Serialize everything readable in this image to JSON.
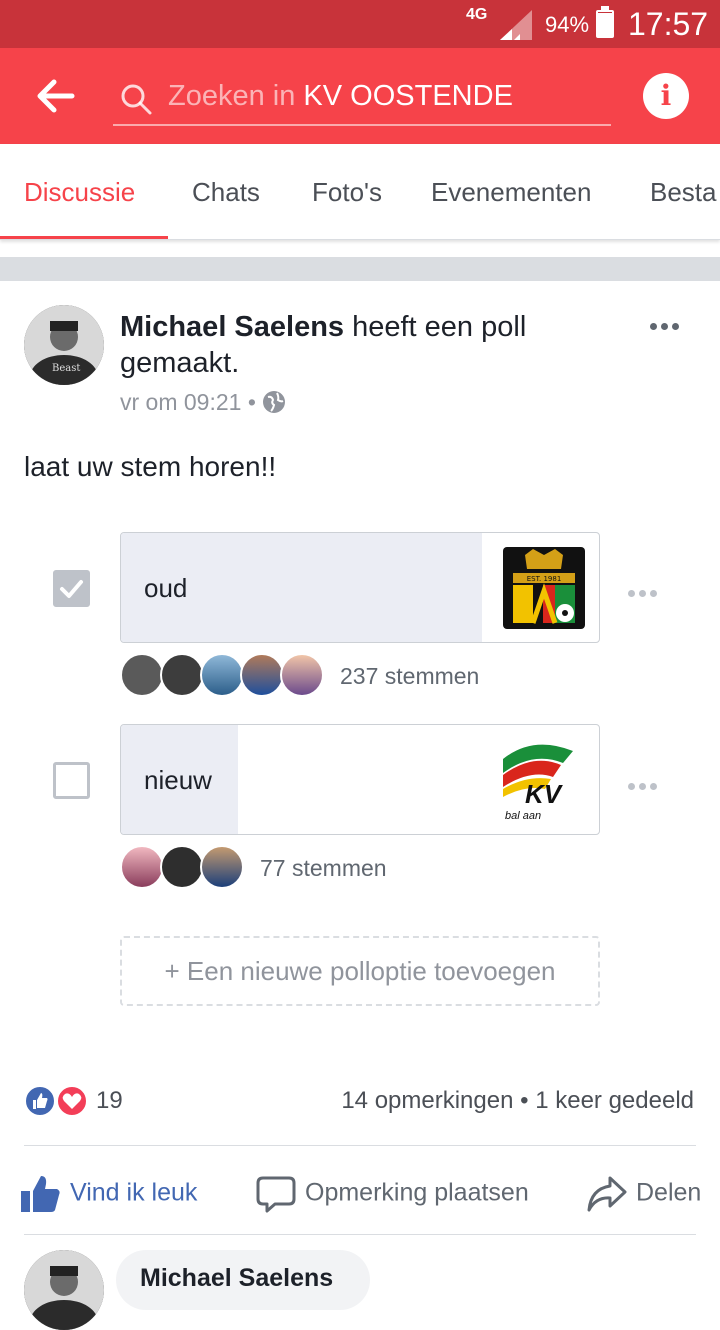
{
  "status": {
    "network": "4G",
    "battery": "94%",
    "battery_level": 0.94,
    "time": "17:57"
  },
  "appbar": {
    "search_placeholder": "Zoeken in ",
    "search_group": "KV OOSTENDE",
    "back_icon": "arrow-left-icon",
    "info_icon": "info-icon"
  },
  "tabs": [
    "Discussie",
    "Chats",
    "Foto's",
    "Evenementen",
    "Besta"
  ],
  "post": {
    "author": "Michael Saelens",
    "action": " heeft een poll gemaakt.",
    "time": "vr om 09:21",
    "privacy_icon": "globe-icon",
    "text": "laat uw stem horen!!",
    "options": [
      {
        "label": "oud",
        "votes": "237 stemmen",
        "checked": true,
        "share": 0.755
      },
      {
        "label": "nieuw",
        "votes": "77 stemmen",
        "checked": false,
        "share": 0.245
      }
    ],
    "add_option": "+ Een nieuwe polloptie toevoegen",
    "reaction_count": "19",
    "comments": "14 opmerkingen",
    "shares": "1 keer gedeeld",
    "separator": " • ",
    "actions": {
      "like": "Vind ik leuk",
      "comment": "Opmerking plaatsen",
      "share": "Delen"
    },
    "comment_preview_name": "Michael Saelens"
  },
  "colors": {
    "brand": "#f6434a",
    "statusbar": "#c8333a",
    "like_blue": "#4267b2"
  }
}
